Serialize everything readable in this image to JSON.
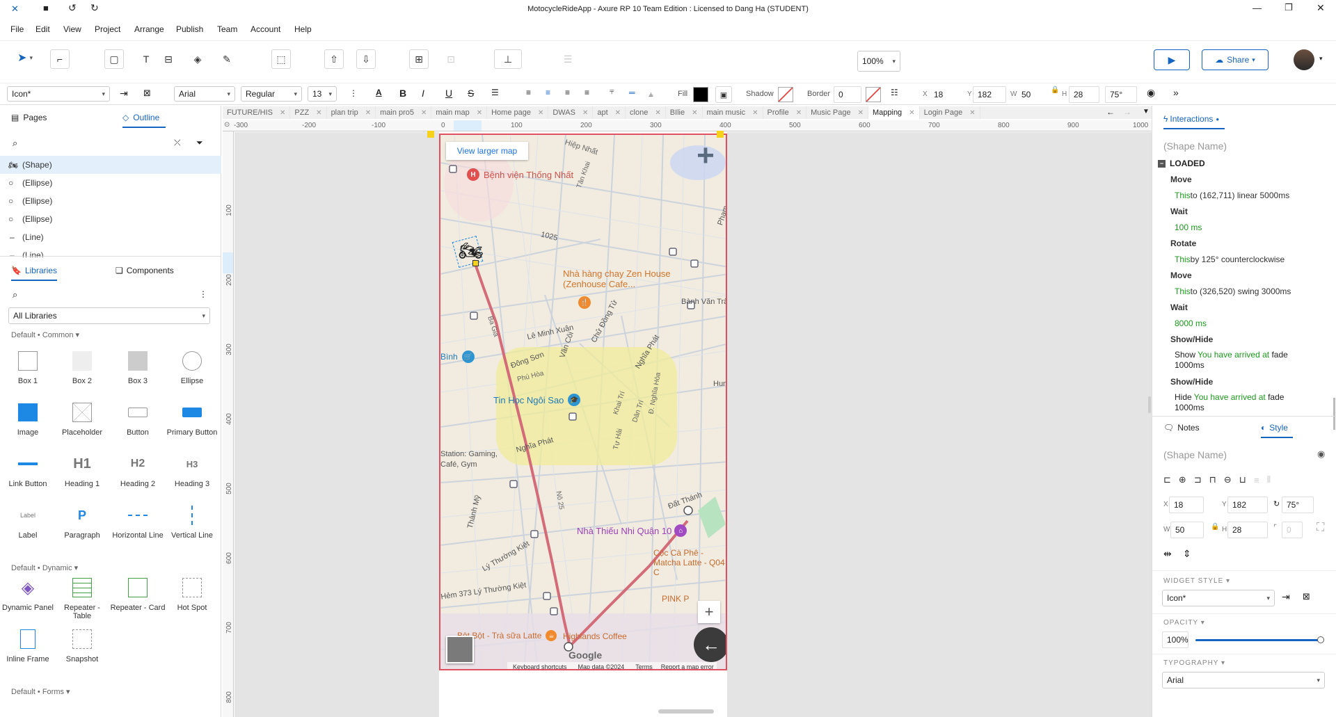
{
  "titlebar": {
    "title": "MotocycleRideApp - Axure RP 10 Team Edition : Licensed to Dang Ha (STUDENT)"
  },
  "menu": [
    "File",
    "Edit",
    "View",
    "Project",
    "Arrange",
    "Publish",
    "Team",
    "Account",
    "Help"
  ],
  "toolbar": {
    "zoom": "100%",
    "share_label": "Share"
  },
  "styleBar": {
    "widget_style": "Icon*",
    "font": "Arial",
    "weight": "Regular",
    "size": "13",
    "fill_label": "Fill",
    "shadow_label": "Shadow",
    "border_label": "Border",
    "border_value": "0",
    "x_label": "X",
    "x": "18",
    "y_label": "Y",
    "y": "182",
    "w_label": "W",
    "w": "50",
    "h_label": "H",
    "h": "28",
    "rotation": "75°"
  },
  "leftPanel": {
    "tab_pages": "Pages",
    "tab_outline": "Outline",
    "outline": [
      "(Shape)",
      "(Ellipse)",
      "(Ellipse)",
      "(Ellipse)",
      "(Line)",
      "(Line)"
    ],
    "tab_libraries": "Libraries",
    "tab_components": "Components",
    "library_select": "All Libraries",
    "section_common": "Default • Common",
    "section_dynamic": "Default • Dynamic",
    "section_forms": "Default • Forms",
    "common_items": [
      "Box 1",
      "Box 2",
      "Box 3",
      "Ellipse",
      "Image",
      "Placeholder",
      "Button",
      "Primary Button",
      "Link Button",
      "Heading 1",
      "Heading 2",
      "Heading 3",
      "Label",
      "Paragraph",
      "Horizontal Line",
      "Vertical Line"
    ],
    "dynamic_items": [
      "Dynamic Panel",
      "Repeater - Table",
      "Repeater - Card",
      "Hot Spot",
      "Inline Frame",
      "Snapshot"
    ]
  },
  "pageTabs": [
    "FUTURE/HIS",
    "PZZ",
    "plan trip",
    "main pro5",
    "main map",
    "Home page",
    "DWAS",
    "apt",
    "clone",
    "BIlie",
    "main music",
    "Profile",
    "Music Page",
    "Mapping",
    "Login Page"
  ],
  "activeTab": "Mapping",
  "ruler": {
    "h": [
      "-300",
      "-200",
      "-100",
      "0",
      "100",
      "200",
      "300",
      "400",
      "500",
      "600",
      "700",
      "800",
      "900",
      "1000"
    ],
    "v": [
      "100",
      "200",
      "300",
      "400",
      "500",
      "600",
      "700",
      "800"
    ]
  },
  "map": {
    "view_larger": "View larger map",
    "labels": [
      "Bệnh viện Thống Nhất",
      "Nhà hàng chay Zen House (Zenhouse Cafe...",
      "Bành Văn Trân",
      "Lê Minh Xuân",
      "Đông Sơn",
      "Văn Côi",
      "Chử Đồng Tử",
      "Nghĩa Phát",
      "Phú Hòa",
      "Tin Học Ngôi Sao",
      "Khai Trí",
      "Dân Trí",
      "Đ. Nghĩa Hòa",
      "Station: Gaming, Café, Gym",
      "Nhà Thiếu Nhi Quận 10",
      "Cộc Cà Phê - Matcha Latte - Q04 C",
      "PINK P",
      "Đất Thánh",
      "Thành Mỹ",
      "Lý Thường Kiệt",
      "Hẻm 373 Lý Thường Kiệt",
      "Bột Bột - Trà sữa Latte",
      "Highlands Coffee",
      "Bình",
      "Hiệp Nhất",
      "Tân Khai",
      "1025",
      "Ba Gia",
      "Nghĩa Phát",
      "Tự Hải",
      "Hum",
      "Phạm",
      "Nô 25"
    ],
    "footer": [
      "Keyboard shortcuts",
      "Map data ©2024",
      "Terms",
      "Report a map error"
    ],
    "google": "Google"
  },
  "rightPanel": {
    "tab_interactions": "Interactions",
    "shape_name_placeholder": "(Shape Name)",
    "event": "LOADED",
    "actions": [
      {
        "name": "Move",
        "target": "This",
        "detail": " to (162,711) linear 5000ms"
      },
      {
        "name": "Wait",
        "target": "",
        "detail": "100 ms"
      },
      {
        "name": "Rotate",
        "target": "This",
        "detail": " by 125° counterclockwise"
      },
      {
        "name": "Move",
        "target": "This",
        "detail": " to (326,520) swing 3000ms"
      },
      {
        "name": "Wait",
        "target": "",
        "detail": "8000 ms"
      },
      {
        "name": "Show/Hide",
        "target": "Show ",
        "detail": "You have arrived at",
        "suffix": " fade",
        "line2": "1000ms"
      },
      {
        "name": "Show/Hide",
        "target": "Hide ",
        "detail": "You have arrived at",
        "suffix": " fade",
        "line2": "1000ms"
      }
    ],
    "tab_notes": "Notes",
    "tab_style": "Style",
    "x": "18",
    "y": "182",
    "rot": "75°",
    "w": "50",
    "h": "28",
    "r": "0",
    "widget_style_title": "WIDGET STYLE",
    "widget_style": "Icon*",
    "opacity_title": "OPACITY",
    "opacity": "100%",
    "opacity_level": 1.0,
    "typography_title": "TYPOGRAPHY",
    "font": "Arial"
  }
}
